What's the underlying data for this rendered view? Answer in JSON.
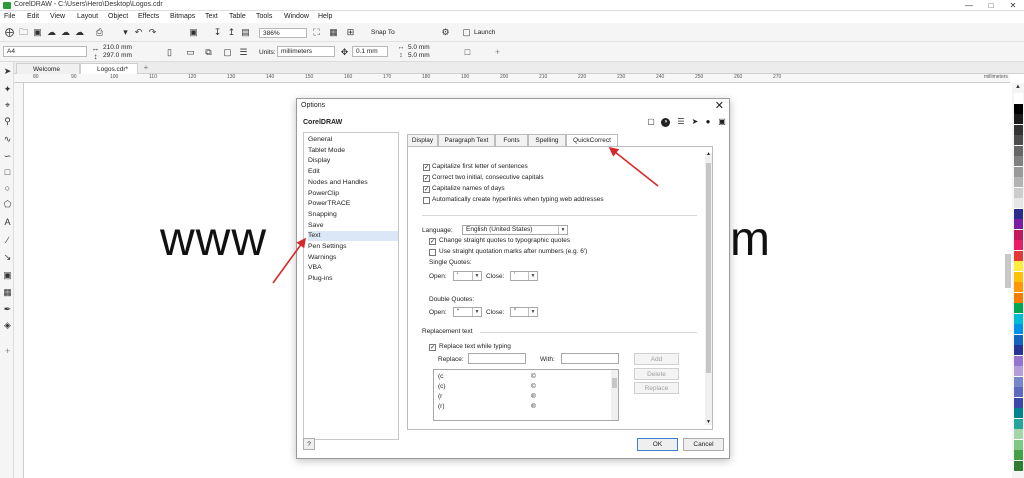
{
  "window": {
    "title": "CorelDRAW - C:\\Users\\Hero\\Desktop\\Logos.cdr",
    "controls": [
      "—",
      "□",
      "✕"
    ]
  },
  "menu": [
    "File",
    "Edit",
    "View",
    "Layout",
    "Object",
    "Effects",
    "Bitmaps",
    "Text",
    "Table",
    "Tools",
    "Window",
    "Help"
  ],
  "toolbar": {
    "zoom": "386%",
    "snap_to": "Snap To",
    "launch": "Launch"
  },
  "propbar": {
    "page_size": "A4",
    "width": "210.0 mm",
    "height": "297.0 mm",
    "units_label": "Units:",
    "units": "millimeters",
    "nudge": "0.1 mm",
    "dup_x": "5.0 mm",
    "dup_y": "5.0 mm"
  },
  "doc_tabs": [
    "Welcome Screen",
    "Logos.cdr*"
  ],
  "ruler": {
    "unit": "millimeters",
    "ticks": [
      "80",
      "90",
      "100",
      "110",
      "120",
      "130",
      "140",
      "150",
      "160",
      "170",
      "180",
      "190",
      "200",
      "210",
      "220",
      "230",
      "240",
      "250",
      "260",
      "270"
    ]
  },
  "canvas": {
    "text_left": "www",
    "text_right": "m"
  },
  "palette_colors": [
    "#ffffff",
    "#000000",
    "#1a1a1a",
    "#333333",
    "#4d4d4d",
    "#666666",
    "#808080",
    "#999999",
    "#b3b3b3",
    "#cccccc",
    "#e6e6e6",
    "#2b2b8c",
    "#7b1fa2",
    "#c2185b",
    "#e91e63",
    "#e53935",
    "#ffeb3b",
    "#ffc107",
    "#ff9800",
    "#f57c00",
    "#00a651",
    "#00bcd4",
    "#0091ea",
    "#1565c0",
    "#283593",
    "#9575cd",
    "#b39ddb",
    "#7986cb",
    "#5c6bc0",
    "#3949ab",
    "#00838f",
    "#26a69a",
    "#a5d6a7",
    "#81c784",
    "#43a047",
    "#2e7d32"
  ],
  "dialog": {
    "title": "Options",
    "header": "CorelDRAW",
    "header_icons": [
      "page-icon",
      "corel-balloon-icon",
      "list-icon",
      "pointer-icon",
      "pin-icon",
      "monitor-icon"
    ],
    "tree": [
      "General",
      "Tablet Mode",
      "Display",
      "Edit",
      "Nodes and Handles",
      "PowerClip",
      "PowerTRACE",
      "Snapping",
      "Save",
      "Text",
      "Pen Settings",
      "Warnings",
      "VBA",
      "Plug-ins"
    ],
    "selected": "Text",
    "tabs": [
      "Display",
      "Paragraph Text",
      "Fonts",
      "Spelling",
      "QuickCorrect"
    ],
    "active_tab": "QuickCorrect",
    "options": [
      {
        "label": "Capitalize first letter of sentences",
        "checked": true
      },
      {
        "label": "Correct two initial, consecutive capitals",
        "checked": true
      },
      {
        "label": "Capitalize names of days",
        "checked": true
      },
      {
        "label": "Automatically create hyperlinks when typing web addresses",
        "checked": false
      }
    ],
    "language_label": "Language:",
    "language": "English (United States)",
    "quote_opts": [
      {
        "label": "Change straight quotes to typographic quotes",
        "checked": true
      },
      {
        "label": "Use straight quotation marks after numbers (e.g. 6')",
        "checked": false
      }
    ],
    "single_quotes": "Single Quotes:",
    "double_quotes": "Double Quotes:",
    "open_label": "Open:",
    "close_label": "Close:",
    "single_open": "‘",
    "single_close": "’",
    "double_open": "“",
    "double_close": "”",
    "replacement_header": "Replacement text",
    "replace_while_typing": {
      "label": "Replace text while typing",
      "checked": true
    },
    "replace_label": "Replace:",
    "with_label": "With:",
    "replace_rows": [
      {
        "from": "(c",
        "to": "©"
      },
      {
        "from": "(c)",
        "to": "©"
      },
      {
        "from": "(r",
        "to": "®"
      },
      {
        "from": "(r)",
        "to": "®"
      }
    ],
    "buttons": {
      "add": "Add",
      "delete": "Delete",
      "replace": "Replace",
      "help": "?",
      "ok": "OK",
      "cancel": "Cancel"
    }
  }
}
